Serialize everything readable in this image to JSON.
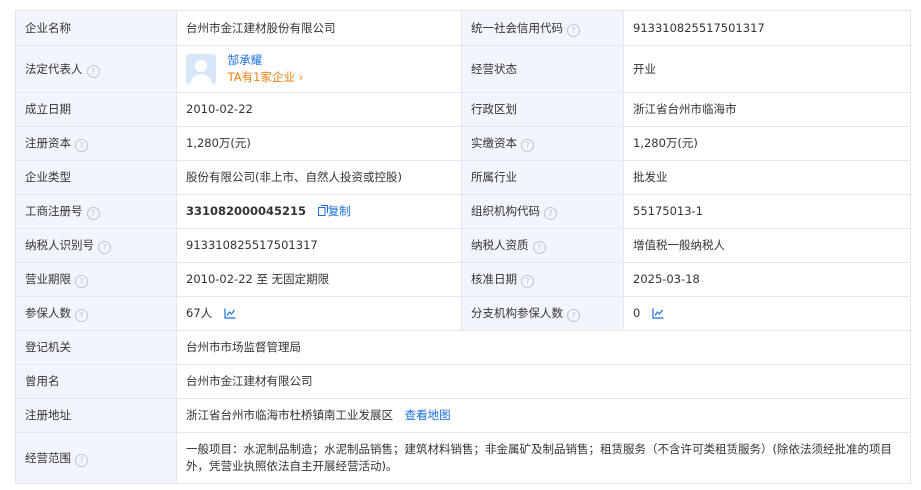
{
  "rows": {
    "company_name": {
      "label": "企业名称",
      "value": "台州市金江建材股份有限公司"
    },
    "credit_code": {
      "label": "统一社会信用代码",
      "value": "913310825517501317"
    },
    "legal_rep": {
      "label": "法定代表人",
      "name": "郜承耀",
      "more": "TA有1家企业",
      "more_arrow": "›"
    },
    "status": {
      "label": "经营状态",
      "value": "开业"
    },
    "founded": {
      "label": "成立日期",
      "value": "2010-02-22"
    },
    "region": {
      "label": "行政区划",
      "value": "浙江省台州市临海市"
    },
    "reg_capital": {
      "label": "注册资本",
      "value": "1,280万(元)"
    },
    "paid_capital": {
      "label": "实缴资本",
      "value": "1,280万(元)"
    },
    "company_type": {
      "label": "企业类型",
      "value": "股份有限公司(非上市、自然人投资或控股)"
    },
    "industry": {
      "label": "所属行业",
      "value": "批发业"
    },
    "reg_no": {
      "label": "工商注册号",
      "value": "331082000045215",
      "copy": "复制"
    },
    "org_code": {
      "label": "组织机构代码",
      "value": "55175013-1"
    },
    "taxpayer_id": {
      "label": "纳税人识别号",
      "value": "913310825517501317"
    },
    "taxpayer_qual": {
      "label": "纳税人资质",
      "value": "增值税一般纳税人"
    },
    "term": {
      "label": "营业期限",
      "value": "2010-02-22 至 无固定期限"
    },
    "approved": {
      "label": "核准日期",
      "value": "2025-03-18"
    },
    "insured": {
      "label": "参保人数",
      "value": "67人"
    },
    "branch_insured": {
      "label": "分支机构参保人数",
      "value": "0"
    },
    "authority": {
      "label": "登记机关",
      "value": "台州市市场监督管理局"
    },
    "former_name": {
      "label": "曾用名",
      "value": "台州市金江建材有限公司"
    },
    "address": {
      "label": "注册地址",
      "value": "浙江省台州市临海市杜桥镇南工业发展区",
      "map": "查看地图"
    },
    "scope": {
      "label": "经营范围",
      "value": "一般项目：水泥制品制造；水泥制品销售；建筑材料销售；非金属矿及制品销售；租赁服务（不含许可类租赁服务）(除依法须经批准的项目外，凭营业执照依法自主开展经营活动)。"
    }
  },
  "icons": {
    "help": "question-circle-icon",
    "copy": "copy-icon",
    "trend": "line-chart-icon"
  },
  "colors": {
    "label_bg": "#f2f6fc",
    "link": "#1a6fe0",
    "accent": "#f07f0c",
    "border": "#e4e7ed"
  }
}
